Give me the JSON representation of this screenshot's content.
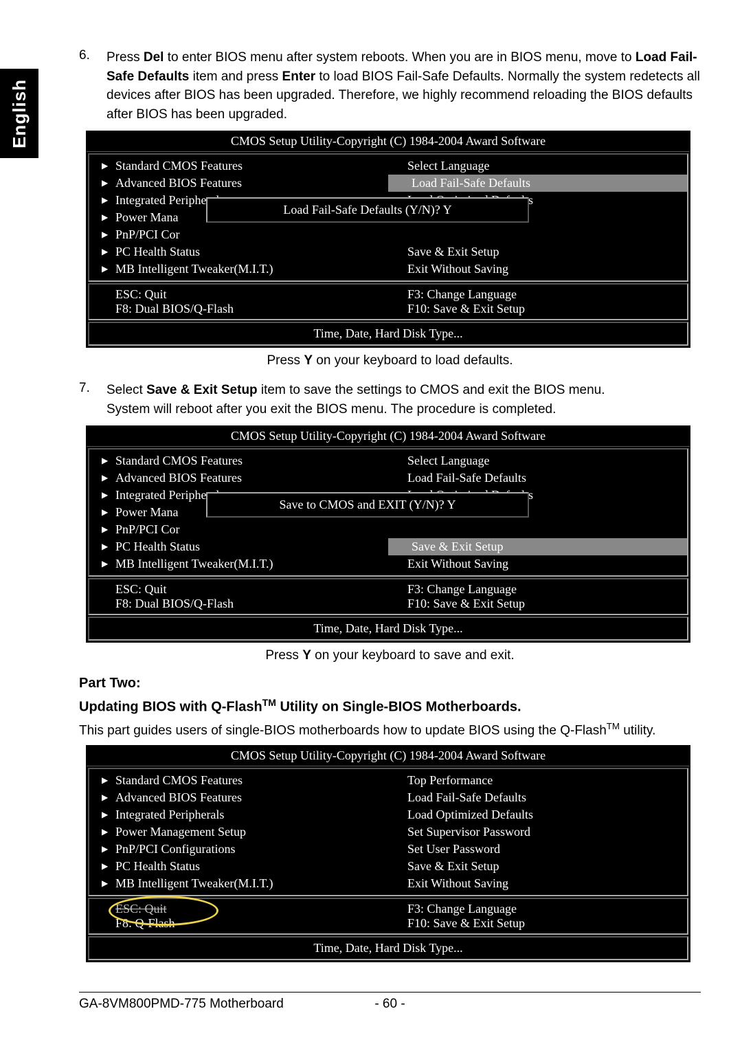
{
  "lang_tab": "English",
  "steps": {
    "s6": {
      "num": "6.",
      "text_html": "Press |Del| to enter BIOS menu after system reboots. When you are in BIOS menu, move to |Load Fail-Safe Defaults| item and press |Enter| to load BIOS Fail-Safe Defaults. Normally the system redetects all devices after BIOS has been upgraded. Therefore, we highly recommend reloading the BIOS defaults after BIOS has been upgraded."
    },
    "s7": {
      "num": "7.",
      "line1_a": "Select ",
      "line1_b": "Save & Exit Setup",
      "line1_c": " item to save the settings to CMOS and exit the BIOS menu.",
      "line2": "System will reboot after you exit the BIOS menu. The procedure is completed."
    }
  },
  "bios": {
    "title": "CMOS Setup Utility-Copyright (C) 1984-2004 Award Software",
    "left": [
      "Standard CMOS Features",
      "Advanced BIOS Features",
      "Integrated Peripherals",
      "Power Management Setup",
      "PnP/PCI Configurations",
      "PC Health Status",
      "MB Intelligent Tweaker(M.I.T.)"
    ],
    "left_trunc": {
      "3": "Power Mana",
      "4": "PnP/PCI Cor"
    },
    "right1": [
      "Select Language",
      "Load Fail-Safe Defaults",
      "Load Optimized Defaults",
      "",
      "",
      "Save & Exit Setup",
      "Exit Without Saving"
    ],
    "right3": [
      "Top Performance",
      "Load Fail-Safe Defaults",
      "Load Optimized Defaults",
      "Set Supervisor Password",
      "Set User Password",
      "Save & Exit Setup",
      "Exit Without Saving"
    ],
    "dialog1": "Load Fail-Safe Defaults (Y/N)? Y",
    "dialog2": "Save to CMOS and EXIT (Y/N)? Y",
    "foot": {
      "esc": "ESC: Quit",
      "f3": "F3: Change Language",
      "f8a": "F8: Dual BIOS/Q-Flash",
      "f8b": "F8: Q-Flash",
      "f10": "F10: Save & Exit Setup"
    },
    "help": "Time, Date, Hard Disk Type..."
  },
  "cap1_a": "Press ",
  "cap1_b": "Y",
  "cap1_c": " on your keyboard to load defaults.",
  "cap2_a": "Press ",
  "cap2_b": "Y",
  "cap2_c": " on your keyboard to save and exit.",
  "part_two": {
    "h3": "Part Two:",
    "h4_a": "Updating BIOS with Q-Flash",
    "h4_tm": "TM",
    "h4_b": " Utility on Single-BIOS Motherboards.",
    "p_a": "This part guides users of single-BIOS motherboards how to update BIOS using the Q-Flash",
    "p_tm": "TM",
    "p_b": " utility."
  },
  "footer": {
    "model": "GA-8VM800PMD-775 Motherboard",
    "page": "- 60 -"
  }
}
